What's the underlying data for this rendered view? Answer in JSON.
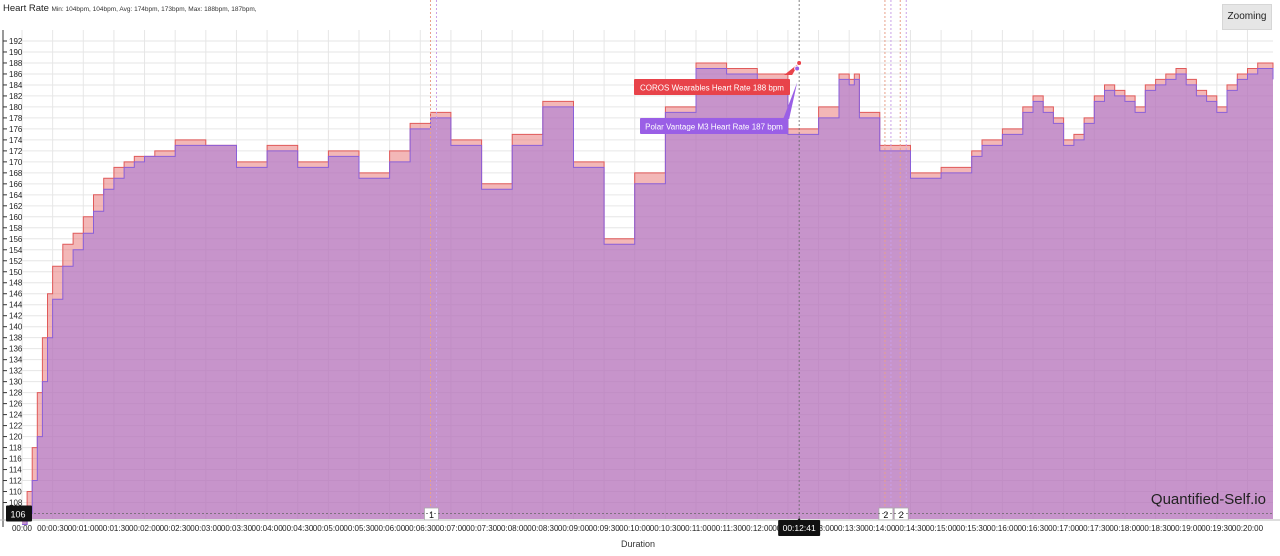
{
  "header": {
    "title": "Heart Rate",
    "stats": "Min: 104bpm, 104bpm, Avg: 174bpm, 173bpm, Max: 188bpm, 187bpm,"
  },
  "toolbar": {
    "zoom_label": "Zooming"
  },
  "watermark": "Quantified-Self.io",
  "tooltips": {
    "coros": "COROS Wearables Heart Rate 188 bpm",
    "polar": "Polar Vantage M3 Heart Rate 187 bpm"
  },
  "crosshair": {
    "x_label": "00:12:41",
    "y_label": "106"
  },
  "lap_markers": [
    {
      "label": "1",
      "time": "00:06:40"
    },
    {
      "label": "2",
      "time": "00:14:05"
    },
    {
      "label": "2",
      "time": "00:14:20"
    }
  ],
  "colors": {
    "coros": "#e8706f",
    "polar": "#9b72e0",
    "tooltip_coros": "#e8434a",
    "tooltip_polar": "#9a5fe6",
    "grid": "#e6e6e6"
  },
  "chart_data": {
    "type": "area",
    "xlabel": "Duration",
    "ylabel": "",
    "ylim": [
      105,
      194
    ],
    "xlim_seconds": [
      0,
      1225
    ],
    "y_ticks": [
      108,
      110,
      112,
      114,
      116,
      118,
      120,
      122,
      124,
      126,
      128,
      130,
      132,
      134,
      136,
      138,
      140,
      142,
      144,
      146,
      148,
      150,
      152,
      154,
      156,
      158,
      160,
      162,
      164,
      166,
      168,
      170,
      172,
      174,
      176,
      178,
      180,
      182,
      184,
      186,
      188,
      190,
      192
    ],
    "x_tick_labels": [
      "00:00",
      "00:00:30",
      "00:01:00",
      "00:01:30",
      "00:02:00",
      "00:02:30",
      "00:03:00",
      "00:03:30",
      "00:04:00",
      "00:04:30",
      "00:05:00",
      "00:05:30",
      "00:06:00",
      "00:06:30",
      "00:07:00",
      "00:07:30",
      "00:08:00",
      "00:08:30",
      "00:09:00",
      "00:09:30",
      "00:10:00",
      "00:10:30",
      "00:11:00",
      "00:11:30",
      "00:12:00",
      "00:12:30",
      "00:13:00",
      "00:13:30",
      "00:14:00",
      "00:14:30",
      "00:15:00",
      "00:15:30",
      "00:16:00",
      "00:16:30",
      "00:17:00",
      "00:17:30",
      "00:18:00",
      "00:18:30",
      "00:19:00",
      "00:19:30",
      "00:20:00"
    ],
    "series": [
      {
        "name": "COROS Wearables Heart Rate",
        "t": [
          0,
          5,
          10,
          15,
          20,
          25,
          30,
          40,
          50,
          60,
          70,
          80,
          90,
          100,
          110,
          120,
          130,
          150,
          180,
          210,
          240,
          270,
          300,
          330,
          360,
          380,
          400,
          420,
          450,
          480,
          510,
          540,
          570,
          600,
          630,
          660,
          690,
          720,
          750,
          780,
          800,
          810,
          815,
          820,
          840,
          870,
          900,
          930,
          940,
          960,
          980,
          990,
          1000,
          1010,
          1020,
          1030,
          1040,
          1050,
          1060,
          1070,
          1080,
          1090,
          1100,
          1110,
          1120,
          1130,
          1140,
          1150,
          1160,
          1170,
          1180,
          1190,
          1200,
          1210,
          1225
        ],
        "y": [
          104,
          110,
          118,
          128,
          138,
          146,
          151,
          155,
          157,
          160,
          164,
          167,
          169,
          170,
          171,
          171,
          172,
          174,
          173,
          170,
          173,
          170,
          172,
          168,
          172,
          177,
          179,
          174,
          166,
          175,
          181,
          170,
          156,
          168,
          180,
          188,
          187,
          186,
          176,
          180,
          186,
          185,
          186,
          179,
          173,
          168,
          169,
          172,
          174,
          176,
          180,
          182,
          180,
          178,
          174,
          175,
          178,
          182,
          184,
          183,
          182,
          180,
          184,
          185,
          186,
          187,
          185,
          183,
          182,
          180,
          184,
          186,
          187,
          188,
          186
        ]
      },
      {
        "name": "Polar Vantage M3 Heart Rate",
        "t": [
          0,
          5,
          10,
          15,
          20,
          25,
          30,
          40,
          50,
          60,
          70,
          80,
          90,
          100,
          110,
          120,
          130,
          150,
          180,
          210,
          240,
          270,
          300,
          330,
          360,
          380,
          400,
          420,
          450,
          480,
          510,
          540,
          570,
          600,
          630,
          660,
          690,
          720,
          750,
          780,
          800,
          810,
          815,
          820,
          840,
          870,
          900,
          930,
          940,
          960,
          980,
          990,
          1000,
          1010,
          1020,
          1030,
          1040,
          1050,
          1060,
          1070,
          1080,
          1090,
          1100,
          1110,
          1120,
          1130,
          1140,
          1150,
          1160,
          1170,
          1180,
          1190,
          1200,
          1210,
          1225
        ],
        "y": [
          104,
          106,
          112,
          120,
          130,
          138,
          145,
          151,
          154,
          157,
          161,
          165,
          167,
          169,
          170,
          171,
          171,
          173,
          173,
          169,
          172,
          169,
          171,
          167,
          170,
          176,
          178,
          173,
          165,
          173,
          180,
          169,
          155,
          166,
          179,
          187,
          186,
          185,
          175,
          178,
          185,
          184,
          185,
          178,
          172,
          167,
          168,
          171,
          173,
          175,
          179,
          181,
          179,
          177,
          173,
          174,
          177,
          181,
          183,
          182,
          181,
          179,
          183,
          184,
          185,
          186,
          184,
          182,
          181,
          179,
          183,
          185,
          186,
          187,
          185
        ]
      }
    ]
  }
}
